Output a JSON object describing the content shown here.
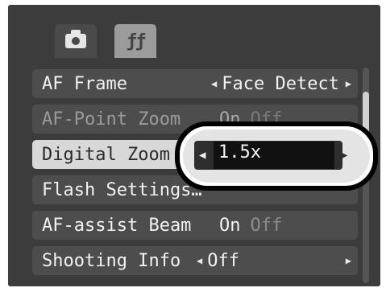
{
  "tabs": [
    {
      "name": "shooting",
      "icon": "camera-icon"
    },
    {
      "name": "setup",
      "icon": "tools-icon",
      "glyph": "ƒƒ"
    }
  ],
  "menu": {
    "items": [
      {
        "label": "AF Frame",
        "value": "Face Detect",
        "type": "selector"
      },
      {
        "label": "AF-Point Zoom",
        "on": "On",
        "off": "Off",
        "type": "toggle",
        "state": "disabled"
      },
      {
        "label": "Digital Zoom",
        "value": "1.5x",
        "type": "selector",
        "state": "selected"
      },
      {
        "label": "Flash Settings…",
        "type": "submenu"
      },
      {
        "label": "AF-assist Beam",
        "on": "On",
        "off": "Off",
        "type": "toggle"
      },
      {
        "label": "Shooting Info",
        "value": "Off",
        "type": "selector"
      }
    ]
  },
  "callout": {
    "value": "1.5x"
  },
  "icons": {
    "left_arrow": "◀",
    "right_arrow": "▶"
  },
  "colors": {
    "background": "#3c3c3c",
    "row": "#4d4d4d",
    "selected_row": "#d8d8d8",
    "callout_border": "#000000"
  }
}
